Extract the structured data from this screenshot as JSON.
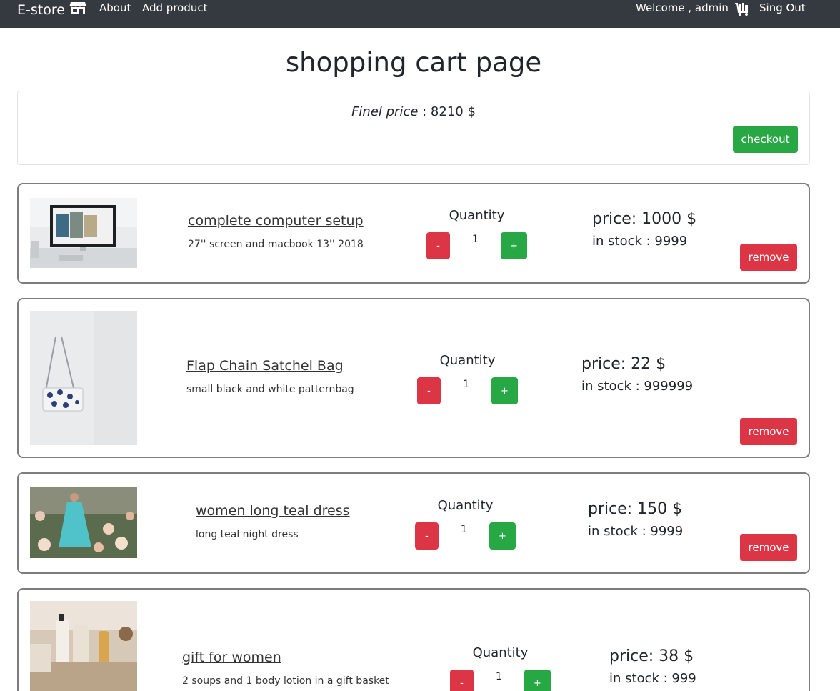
{
  "nav": {
    "brand": "E-store",
    "brand_icon": "store-icon",
    "links": [
      "About",
      "Add product"
    ],
    "welcome": "Welcome , admin",
    "cart_icon": "cart-icon",
    "signout": "Sing Out"
  },
  "page": {
    "title": "shopping cart page"
  },
  "summary": {
    "price_label": "Finel price",
    "price_value": " : 8210 $",
    "checkout_label": "checkout"
  },
  "colors": {
    "navbar": "#343a40",
    "success": "#28a745",
    "danger": "#dc3545",
    "card_border": "#7d7d7d"
  },
  "cart": {
    "quantity_label": "Quantity",
    "minus_label": "-",
    "plus_label": "+",
    "remove_label": "remove",
    "items": [
      {
        "title": "complete computer setup",
        "description": "27'' screen and macbook 13'' 2018",
        "quantity": "1",
        "price": "price: 1000 $",
        "stock": "in stock : 9999",
        "image": "computer-setup-photo"
      },
      {
        "title": "Flap Chain Satchel Bag",
        "description": "small black and white patternbag",
        "quantity": "1",
        "price": "price: 22 $",
        "stock": "in stock : 999999",
        "image": "satchel-bag-photo"
      },
      {
        "title": "women long teal dress",
        "description": "long teal night dress",
        "quantity": "1",
        "price": "price: 150 $",
        "stock": "in stock : 9999",
        "image": "teal-dress-photo"
      },
      {
        "title": "gift for women",
        "description": "2 soups and 1 body lotion in a gift basket",
        "quantity": "1",
        "price": "price: 38 $",
        "stock": "in stock : 999",
        "image": "gift-basket-photo"
      }
    ]
  }
}
